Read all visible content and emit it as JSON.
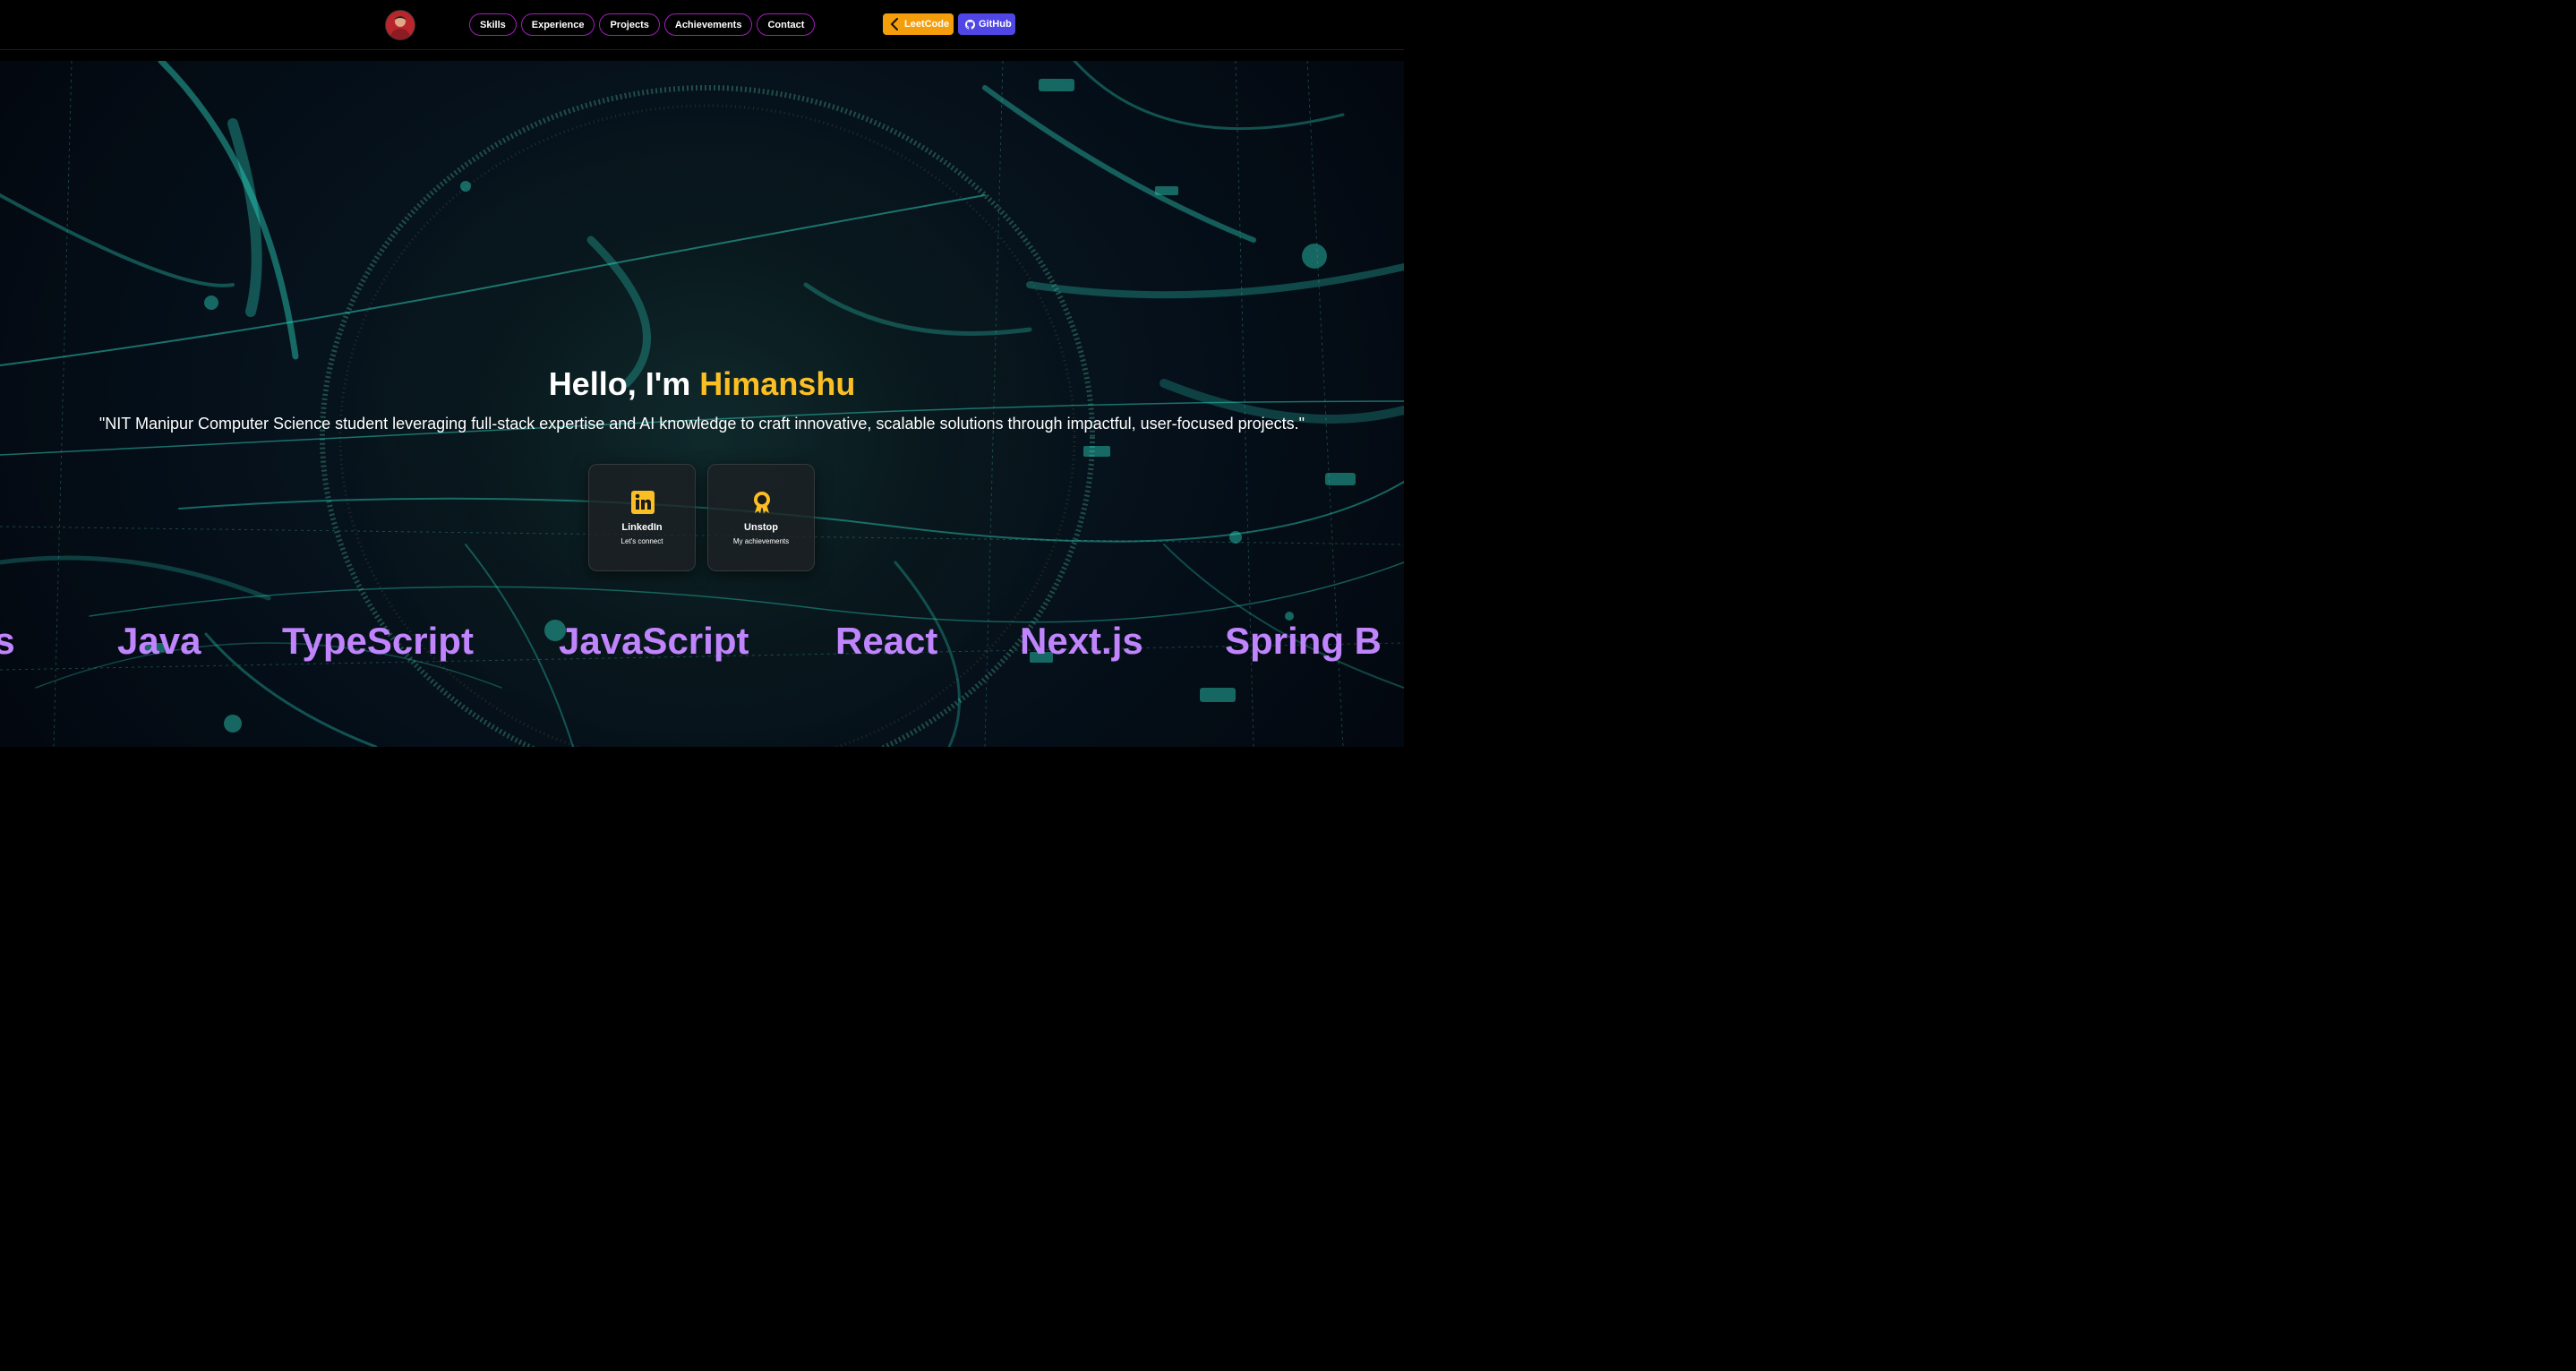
{
  "nav": {
    "items": [
      "Skills",
      "Experience",
      "Projects",
      "Achievements",
      "Contact"
    ]
  },
  "external": {
    "leetcode_label": "LeetCode",
    "github_label": "GitHub"
  },
  "hero": {
    "greeting": "Hello, I'm ",
    "name": "Himanshu",
    "tagline": "\"NIT Manipur Computer Science student leveraging full-stack expertise and AI knowledge to craft innovative, scalable solutions through impactful, user-focused projects.\"",
    "cards": [
      {
        "title": "LinkedIn",
        "subtitle": "Let's connect",
        "icon": "linkedin-icon"
      },
      {
        "title": "Unstop",
        "subtitle": "My achievements",
        "icon": "award-icon"
      }
    ]
  },
  "marquee": {
    "items": [
      "es",
      "Java",
      "TypeScript",
      "JavaScript",
      "React",
      "Next.js",
      "Spring B"
    ]
  },
  "colors": {
    "accent_name": "#fbbf24",
    "nav_border": "#a020b8",
    "leetcode": "#f59e0b",
    "github": "#4f46e5",
    "marquee_text": "#c084fc",
    "network_glow": "#2dd4bf"
  }
}
